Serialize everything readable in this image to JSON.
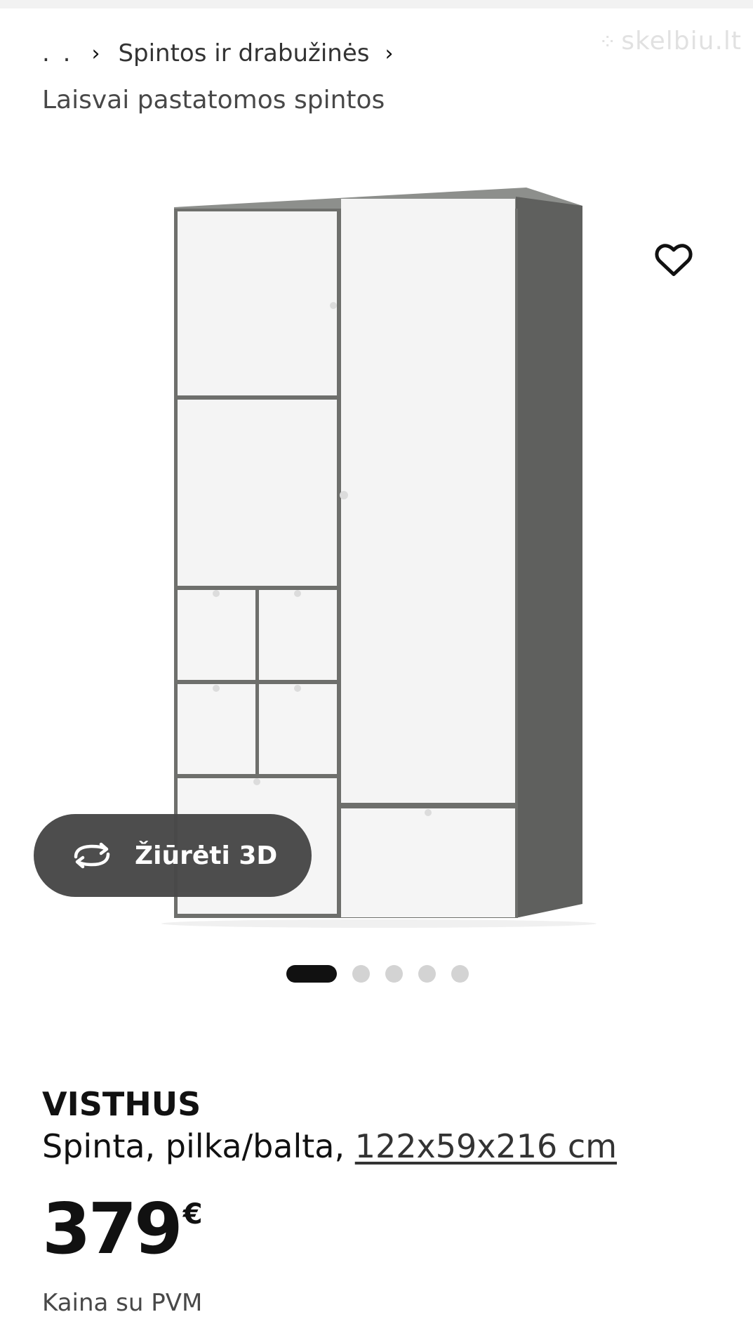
{
  "breadcrumb": {
    "ellipsis": ". .",
    "category": "Spintos ir drabužinės",
    "subcategory": "Laisvai pastatomos spintos"
  },
  "watermark": {
    "text": "skelbiu.lt"
  },
  "gallery": {
    "view_3d_label": "Žiūrėti 3D",
    "image_count": 5,
    "active_index": 0
  },
  "product": {
    "name": "VISTHUS",
    "description": "Spinta, pilka/balta,",
    "dimensions": "122x59x216 cm",
    "price": "379",
    "currency": "€",
    "vat_note": "Kaina su PVM"
  },
  "icons": {
    "breadcrumb_separator": "chevron-right-icon",
    "favorite": "heart-outline-icon",
    "view_3d": "rotate-3d-icon"
  },
  "colors": {
    "wardrobe_frame": "#5f605e",
    "wardrobe_doors": "#f4f4f4",
    "view_3d_button": "#484848",
    "pager_active": "#111111",
    "pager_inactive": "#d3d3d3"
  }
}
